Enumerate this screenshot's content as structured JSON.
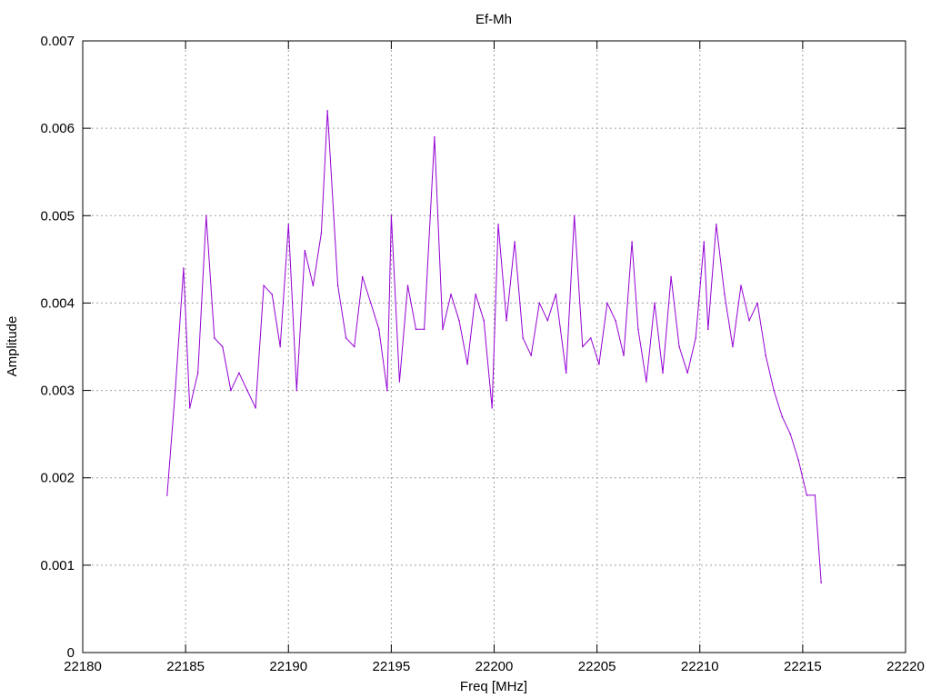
{
  "chart_data": {
    "type": "line",
    "title": "Ef-Mh",
    "xlabel": "Freq [MHz]",
    "ylabel": "Amplitude",
    "xlim": [
      22180,
      22220
    ],
    "ylim": [
      0,
      0.007
    ],
    "x_ticks": [
      22180,
      22185,
      22190,
      22195,
      22200,
      22205,
      22210,
      22215,
      22220
    ],
    "x_tick_labels": [
      "22180",
      "22185",
      "22190",
      "22195",
      "22200",
      "22205",
      "22210",
      "22215",
      "22220"
    ],
    "y_ticks": [
      0,
      0.001,
      0.002,
      0.003,
      0.004,
      0.005,
      0.006,
      0.007
    ],
    "y_tick_labels": [
      "0",
      "0.001",
      "0.002",
      "0.003",
      "0.004",
      "0.005",
      "0.006",
      "0.007"
    ],
    "grid": true,
    "series": [
      {
        "color": "#9400d3",
        "x": [
          22184.1,
          22184.5,
          22184.9,
          22185.2,
          22185.6,
          22186.0,
          22186.4,
          22186.8,
          22187.2,
          22187.6,
          22188.0,
          22188.4,
          22188.8,
          22189.2,
          22189.6,
          22190.0,
          22190.4,
          22190.8,
          22191.2,
          22191.6,
          22191.9,
          22192.4,
          22192.8,
          22193.2,
          22193.6,
          22194.0,
          22194.4,
          22194.8,
          22195.0,
          22195.4,
          22195.8,
          22196.2,
          22196.6,
          22197.1,
          22197.5,
          22197.9,
          22198.3,
          22198.7,
          22199.1,
          22199.5,
          22199.9,
          22200.2,
          22200.6,
          22201.0,
          22201.4,
          22201.8,
          22202.2,
          22202.6,
          22203.0,
          22203.5,
          22203.9,
          22204.3,
          22204.7,
          22205.1,
          22205.5,
          22205.9,
          22206.3,
          22206.7,
          22207.0,
          22207.4,
          22207.8,
          22208.2,
          22208.6,
          22209.0,
          22209.4,
          22209.8,
          22210.2,
          22210.4,
          22210.8,
          22211.2,
          22211.6,
          22212.0,
          22212.4,
          22212.8,
          22213.2,
          22213.6,
          22214.0,
          22214.4,
          22214.8,
          22215.2,
          22215.6,
          22215.9
        ],
        "y": [
          0.0018,
          0.003,
          0.0044,
          0.0028,
          0.0032,
          0.005,
          0.0036,
          0.0035,
          0.003,
          0.0032,
          0.003,
          0.0028,
          0.0042,
          0.0041,
          0.0035,
          0.0049,
          0.003,
          0.0046,
          0.0042,
          0.0048,
          0.0062,
          0.0042,
          0.0036,
          0.0035,
          0.0043,
          0.004,
          0.0037,
          0.003,
          0.005,
          0.0031,
          0.0042,
          0.0037,
          0.0037,
          0.0059,
          0.0037,
          0.0041,
          0.0038,
          0.0033,
          0.0041,
          0.0038,
          0.0028,
          0.0049,
          0.0038,
          0.0047,
          0.0036,
          0.0034,
          0.004,
          0.0038,
          0.0041,
          0.0032,
          0.005,
          0.0035,
          0.0036,
          0.0033,
          0.004,
          0.0038,
          0.0034,
          0.0047,
          0.0037,
          0.0031,
          0.004,
          0.0032,
          0.0043,
          0.0035,
          0.0032,
          0.0036,
          0.0047,
          0.0037,
          0.0049,
          0.0041,
          0.0035,
          0.0042,
          0.0038,
          0.004,
          0.0034,
          0.003,
          0.0027,
          0.0025,
          0.0022,
          0.0018,
          0.0018,
          0.0008
        ]
      }
    ]
  }
}
